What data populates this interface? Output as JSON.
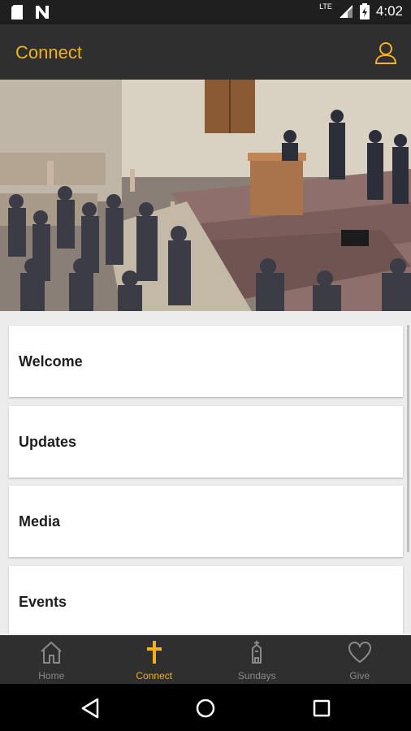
{
  "status_bar": {
    "time": "4:02",
    "network": "LTE"
  },
  "app_bar": {
    "title": "Connect"
  },
  "menu": [
    {
      "label": "Welcome"
    },
    {
      "label": "Updates"
    },
    {
      "label": "Media"
    },
    {
      "label": "Events"
    }
  ],
  "tabs": [
    {
      "label": "Home",
      "icon": "home-icon"
    },
    {
      "label": "Connect",
      "icon": "cross-icon"
    },
    {
      "label": "Sundays",
      "icon": "church-icon"
    },
    {
      "label": "Give",
      "icon": "heart-icon"
    }
  ],
  "active_tab": "Connect",
  "colors": {
    "accent": "#f2b21b",
    "bar": "#2f2f2f",
    "background": "#ececec"
  }
}
